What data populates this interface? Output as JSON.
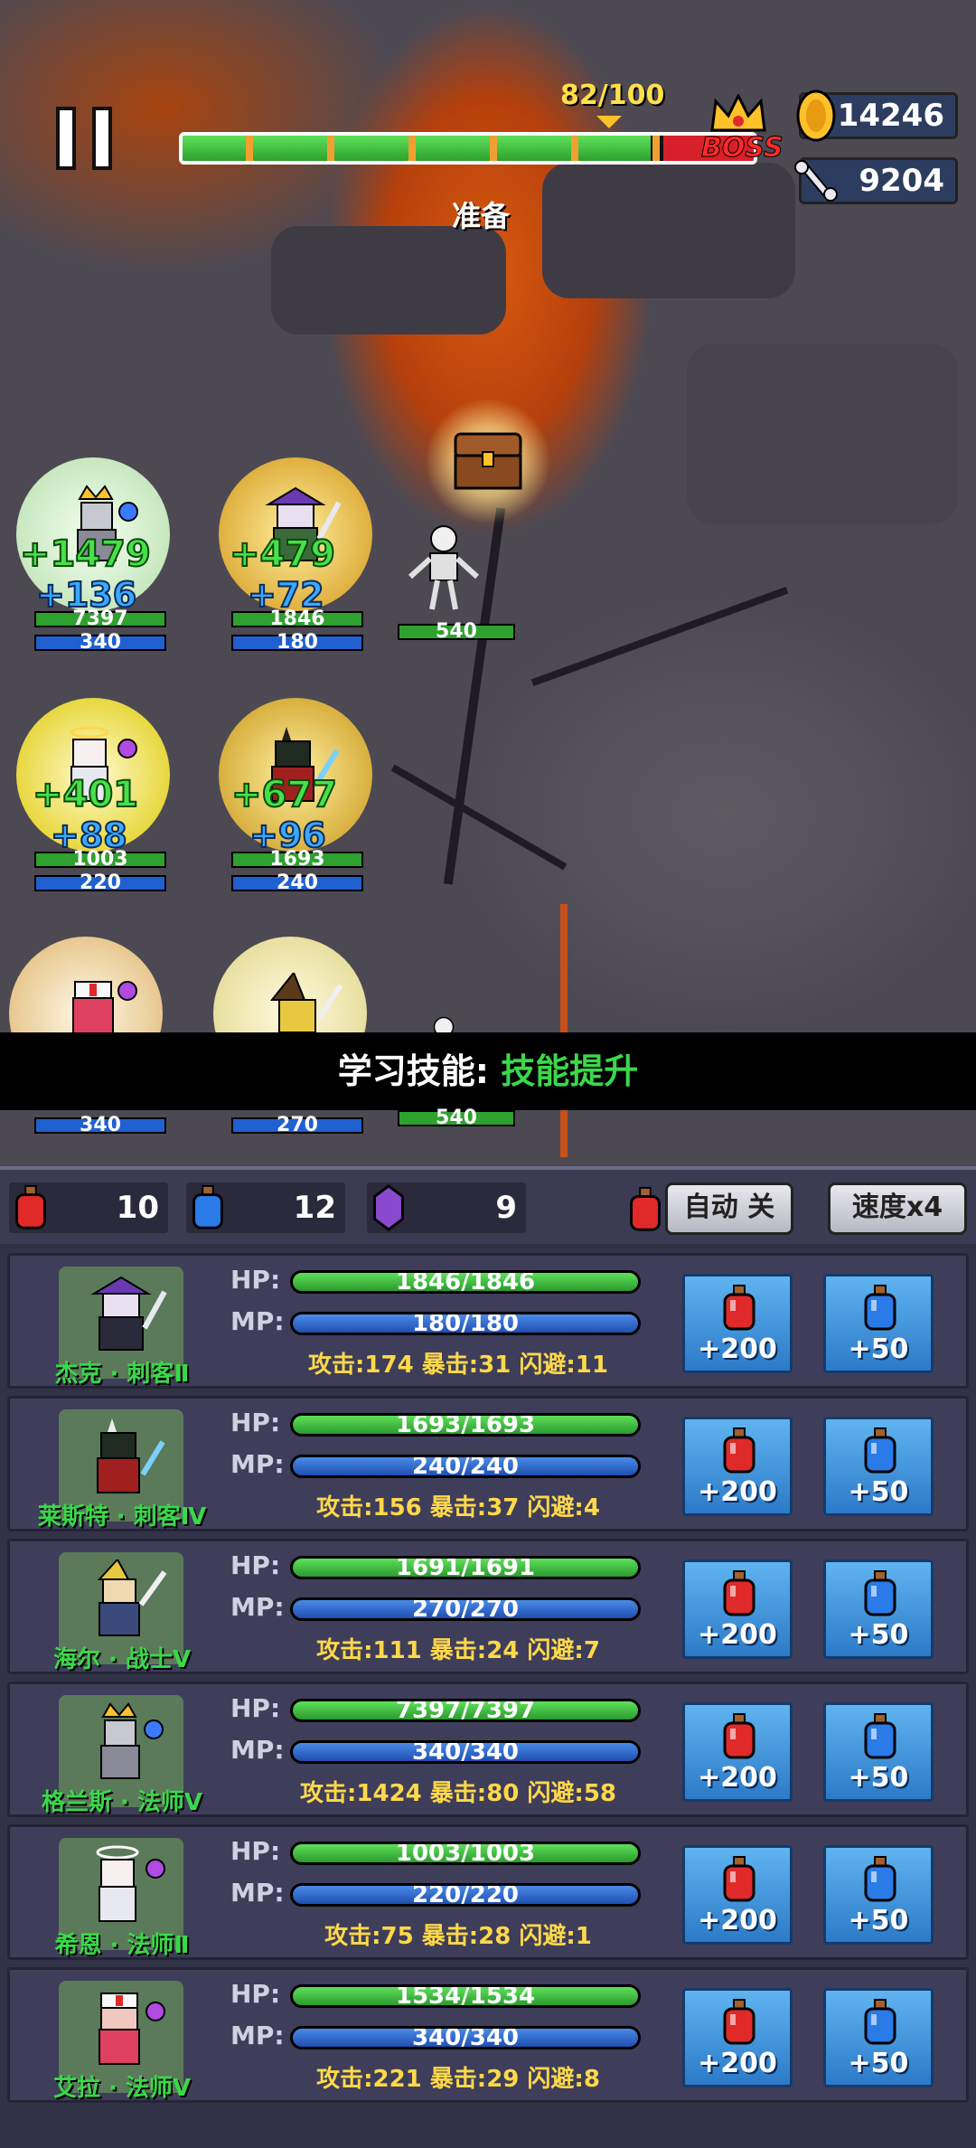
{
  "hud": {
    "wave_progress": "82/100",
    "wave_fraction": 0.82,
    "boss_label": "BOSS",
    "stage_status": "准备",
    "gold": "14246",
    "bones": "9204"
  },
  "battle": {
    "heroes": [
      {
        "heal": "+1479",
        "mana": "+136",
        "hp": "7397",
        "mp": "340"
      },
      {
        "heal": "+479",
        "mana": "+72",
        "hp": "1846",
        "mp": "180"
      },
      {
        "heal": "+401",
        "mana": "+88",
        "hp": "1003",
        "mp": "220"
      },
      {
        "heal": "+677",
        "mana": "+96",
        "hp": "1693",
        "mp": "240"
      },
      {
        "mp": "340"
      },
      {
        "mp": "270"
      }
    ],
    "enemies": [
      {
        "hp": "540"
      },
      {
        "hp": "540"
      }
    ]
  },
  "banner": {
    "prefix": "学习技能: ",
    "highlight": "技能提升"
  },
  "inventory": {
    "red_potions": "10",
    "blue_potions": "12",
    "gems": "9",
    "auto_label": "自动 关",
    "speed_label": "速度x4"
  },
  "labels": {
    "hp": "HP:",
    "mp": "MP:"
  },
  "party": [
    {
      "name": "杰克 · 刺客Ⅱ",
      "hp": "1846/1846",
      "mp": "180/180",
      "stats": "攻击:174  暴击:31  闪避:11",
      "red_btn": "+200",
      "blue_btn": "+50"
    },
    {
      "name": "莱斯特 · 刺客Ⅳ",
      "hp": "1693/1693",
      "mp": "240/240",
      "stats": "攻击:156  暴击:37  闪避:4",
      "red_btn": "+200",
      "blue_btn": "+50"
    },
    {
      "name": "海尔 · 战士Ⅴ",
      "hp": "1691/1691",
      "mp": "270/270",
      "stats": "攻击:111  暴击:24  闪避:7",
      "red_btn": "+200",
      "blue_btn": "+50"
    },
    {
      "name": "格兰斯 · 法师Ⅴ",
      "hp": "7397/7397",
      "mp": "340/340",
      "stats": "攻击:1424  暴击:80  闪避:58",
      "red_btn": "+200",
      "blue_btn": "+50"
    },
    {
      "name": "希恩 · 法师Ⅱ",
      "hp": "1003/1003",
      "mp": "220/220",
      "stats": "攻击:75  暴击:28  闪避:1",
      "red_btn": "+200",
      "blue_btn": "+50"
    },
    {
      "name": "艾拉 · 法师Ⅴ",
      "hp": "1534/1534",
      "mp": "340/340",
      "stats": "攻击:221  暴击:29  闪避:8",
      "red_btn": "+200",
      "blue_btn": "+50"
    }
  ],
  "colors": {
    "accent_green": "#3ad84a",
    "hp_green": "#2ea12e",
    "mp_blue": "#1f4fb0",
    "gold": "#ffd84a",
    "boss_red": "#d8202a"
  }
}
